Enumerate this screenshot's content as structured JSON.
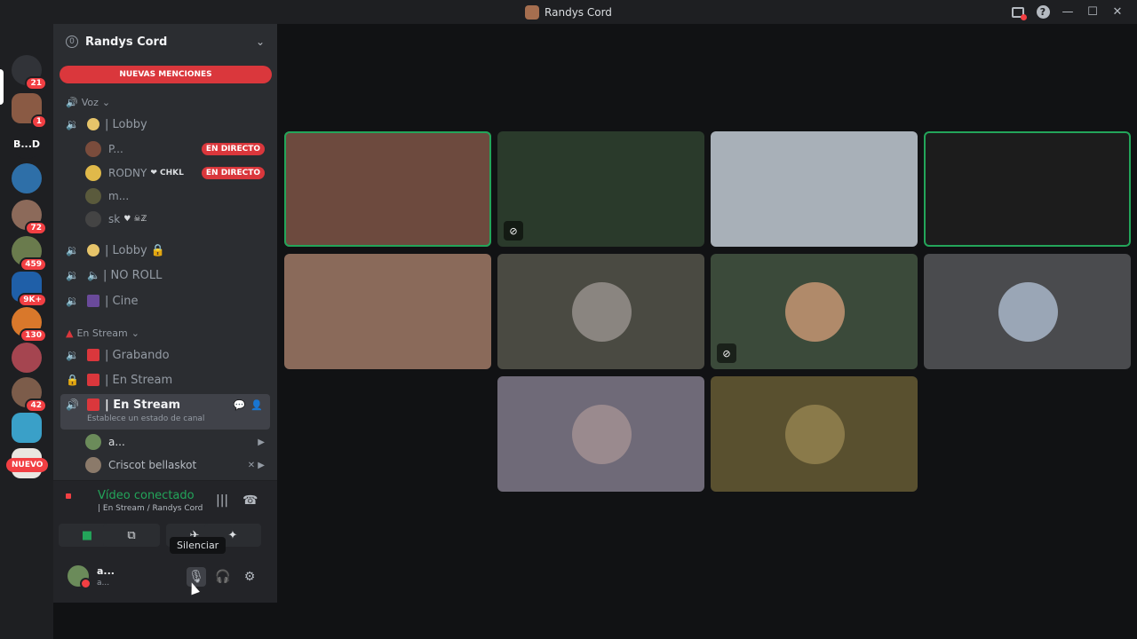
{
  "window": {
    "title": "Randys Cord"
  },
  "colors": {
    "accent_green": "#23a55a",
    "danger_red": "#da373c",
    "badge_red": "#f23f43"
  },
  "rail": {
    "servers": [
      {
        "name": "discord-home",
        "label": "",
        "badge": "21",
        "color": "#313338"
      },
      {
        "name": "server-avatar-1",
        "label": "",
        "badge": "1",
        "color": "#8a5a44"
      },
      {
        "name": "server-bd",
        "label": "B...D",
        "badge": "",
        "color": "#1e1f22"
      },
      {
        "name": "server-game",
        "label": "",
        "badge": "",
        "color": "#2e6fa8"
      },
      {
        "name": "server-avatar-2",
        "label": "",
        "badge": "72",
        "color": "#8c6a5a"
      },
      {
        "name": "server-avatar-3",
        "label": "",
        "badge": "459",
        "color": "#6a7b4d"
      },
      {
        "name": "server-dominican",
        "label": "",
        "badge": "9K+",
        "color": "#1f5fa8"
      },
      {
        "name": "server-fox",
        "label": "",
        "badge": "130",
        "color": "#d9782b"
      },
      {
        "name": "server-avatar-4",
        "label": "",
        "badge": "",
        "color": "#a54550"
      },
      {
        "name": "server-avatar-5",
        "label": "",
        "badge": "42",
        "color": "#7c5c4a"
      },
      {
        "name": "server-avatar-6",
        "label": "",
        "badge": "",
        "color": "#3aa0c8"
      },
      {
        "name": "server-avatar-7",
        "label": "",
        "badge": "",
        "color": "#e9e6e1"
      }
    ],
    "new_label": "NUEVO"
  },
  "sidebar": {
    "server_name": "Randys Cord",
    "boost_level": "0",
    "mentions_label": "NUEVAS MENCIONES",
    "category_voice": "Voz",
    "category_stream": "En Stream",
    "channels": {
      "lobby": "| Lobby",
      "lobby_locked": "| Lobby 🔒",
      "no_roll": "| NO ROLL",
      "cine": "| Cine",
      "grabando": "| Grabando",
      "en_stream_locked": "| En Stream",
      "en_stream_active": "| En Stream",
      "en_stream_status": "Establece un estado de canal"
    },
    "lobby_users": [
      {
        "name": "P...",
        "tail": "",
        "live": "EN DIRECTO",
        "color": "#7a4c3c"
      },
      {
        "name": "RODNY",
        "tail": "❤ CHKL",
        "live": "EN DIRECTO",
        "color": "#e0b94a"
      },
      {
        "name": "m...",
        "tail": "",
        "live": "",
        "color": "#5a5a3c"
      },
      {
        "name": "sk",
        "tail": "♥ ☠ℤ",
        "live": "",
        "color": "#444"
      }
    ],
    "stream_users": [
      {
        "name": "a...",
        "color": "#6b8b5a"
      },
      {
        "name": "Criscot bellaskot",
        "color": "#8b7a6a"
      }
    ]
  },
  "voice_panel": {
    "status": "Vídeo conectado",
    "location": "| En Stream / Randys Cord"
  },
  "tooltip": "Silenciar",
  "user_panel": {
    "name": "a...",
    "status": "a..."
  },
  "tiles": [
    {
      "name": "video-tile-1",
      "bg": "#6d4a3e",
      "speaking": true,
      "muted": false,
      "avatar": ""
    },
    {
      "name": "video-tile-2",
      "bg": "#2a3a2b",
      "speaking": false,
      "muted": true,
      "avatar": ""
    },
    {
      "name": "video-tile-3",
      "bg": "#a8b0b8",
      "speaking": false,
      "muted": false,
      "avatar": ""
    },
    {
      "name": "video-tile-4",
      "bg": "#1c1c1c",
      "speaking": true,
      "muted": false,
      "avatar": ""
    },
    {
      "name": "video-tile-5",
      "bg": "#8a6a5a",
      "speaking": false,
      "muted": false,
      "avatar": ""
    },
    {
      "name": "avatar-tile-6",
      "bg": "#4a4a42",
      "speaking": false,
      "muted": false,
      "avatar": "#8a8580"
    },
    {
      "name": "avatar-tile-7",
      "bg": "#3b4a3a",
      "speaking": false,
      "muted": true,
      "avatar": "#b08a6a"
    },
    {
      "name": "avatar-tile-8",
      "bg": "#4a4b4e",
      "speaking": false,
      "muted": false,
      "avatar": "#9aa6b6"
    },
    {
      "name": "avatar-tile-9",
      "bg": "#6f6a78",
      "speaking": false,
      "muted": false,
      "avatar": "#9a8a8e"
    },
    {
      "name": "avatar-tile-10",
      "bg": "#59502f",
      "speaking": false,
      "muted": false,
      "avatar": "#8a7a4a"
    }
  ]
}
